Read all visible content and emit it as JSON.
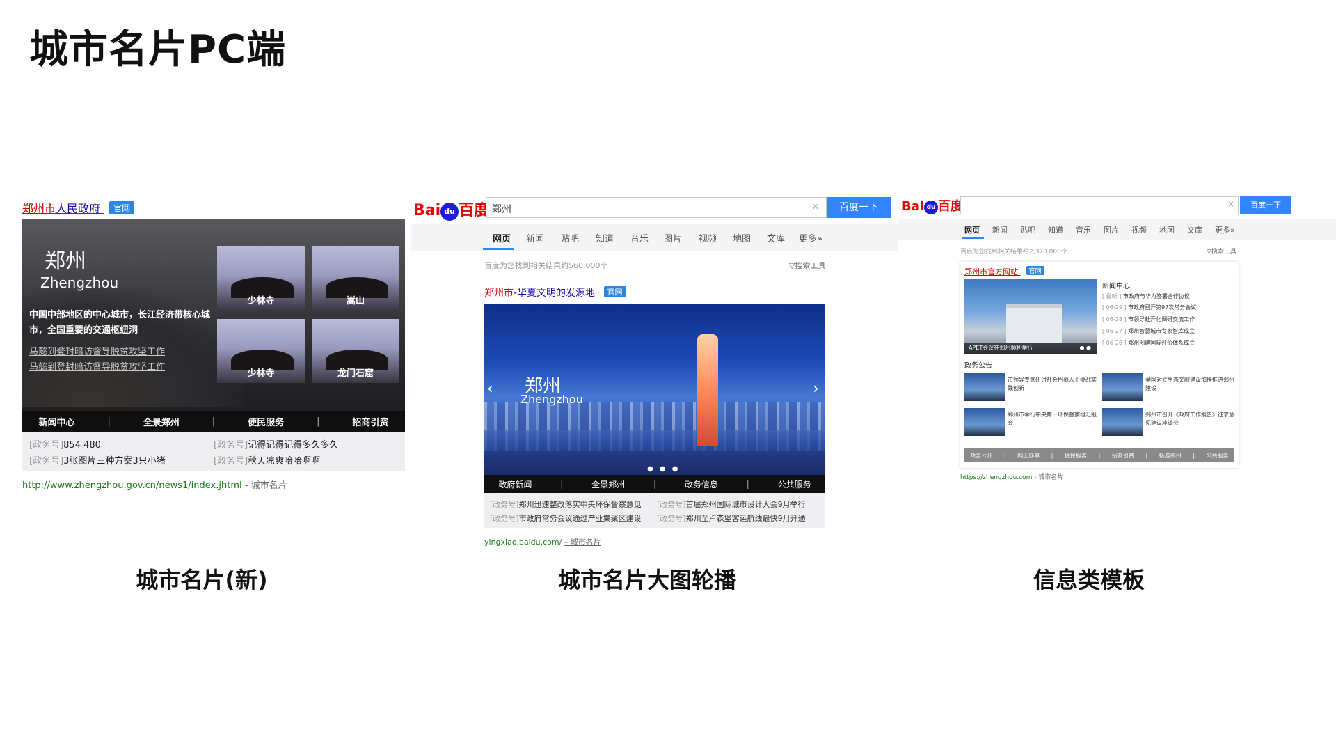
{
  "slide": {
    "title": "城市名片PC端"
  },
  "captions": [
    "城市名片(新)",
    "城市名片大图轮播",
    "信息类模板"
  ],
  "panel1": {
    "title_city": "郑州市",
    "title_rest": "人民政府",
    "badge": "官网",
    "city_cn": "郑州",
    "city_en": "Zhengzhou",
    "desc": "中国中部地区的中心城市，长江经济带核心城市，全国重要的交通枢纽洞",
    "links": [
      "马懿到登封暗访督导脱贫攻坚工作",
      "马懿到登封暗访督导脱贫攻坚工作"
    ],
    "thumbs": [
      "少林寺",
      "嵩山",
      "少林寺",
      "龙门石窟"
    ],
    "nav": [
      "新闻中心",
      "全景郑州",
      "便民服务",
      "招商引资"
    ],
    "info": [
      {
        "tag": "[政务号]",
        "text": "854 480"
      },
      {
        "tag": "[政务号]",
        "text": "记得记得记得多久多久"
      },
      {
        "tag": "[政务号]",
        "text": "3张图片三种方案3只小猪"
      },
      {
        "tag": "[政务号]",
        "text": "秋天凉爽哈哈啊啊"
      }
    ],
    "url": "http://www.zhengzhou.gov.cn/news1/index.jhtml",
    "url_suffix": "- 城市名片"
  },
  "panel2": {
    "logo_bai": "Bai",
    "logo_du": "du",
    "logo_baidu": "百度",
    "search_value": "郑州",
    "clear_icon": "×",
    "search_btn": "百度一下",
    "tabs": [
      "网页",
      "新闻",
      "贴吧",
      "知道",
      "音乐",
      "图片",
      "视频",
      "地图",
      "文库",
      "更多»"
    ],
    "count": "百度为您找到相关结果约560,000个",
    "tools": "▽搜索工具",
    "result_title_red": "郑州市",
    "result_title_rest": "-华夏文明的发源地",
    "badge": "官网",
    "city_cn": "郑州",
    "city_en": "Zhengzhou",
    "arrow_left": "‹",
    "arrow_right": "›",
    "dots": "● ● ●",
    "nav": [
      "政府新闻",
      "全景郑州",
      "政务信息",
      "公共服务"
    ],
    "info": [
      {
        "tag": "[政务号]",
        "text": "郑州迅速整改落实中央环保督察意见"
      },
      {
        "tag": "[政务号]",
        "text": "首届郑州国际城市设计大会9月举行"
      },
      {
        "tag": "[政务号]",
        "text": "市政府常务会议通过产业集聚区建设"
      },
      {
        "tag": "[政务号]",
        "text": "郑州至卢森堡客运航线最快9月开通"
      }
    ],
    "url": "yingxiao.baidu.com/",
    "url_suffix": "– 城市名片"
  },
  "panel3": {
    "logo_bai": "Bai",
    "logo_du": "du",
    "logo_baidu": "百度",
    "search_value": "",
    "clear_icon": "×",
    "search_btn": "百度一下",
    "tabs": [
      "网页",
      "新闻",
      "贴吧",
      "知道",
      "音乐",
      "图片",
      "视频",
      "地图",
      "文库",
      "更多»"
    ],
    "count": "百度为您找到相关结果约2,370,000个",
    "tools": "▽搜索工具",
    "card_title": "郑州市官方网站",
    "badge": "官网",
    "main_img_caption": "APET会议在郑州顺利举行",
    "main_img_dots": "● ●",
    "news_heading": "新闻中心",
    "news": [
      {
        "date": "[ 最新 ]",
        "text": "市政府与华为签署合作协议"
      },
      {
        "date": "[ 06-29 ]",
        "text": "市政府召开第97次常务会议"
      },
      {
        "date": "[ 06-28 ]",
        "text": "市领导赴开化调研交流工作"
      },
      {
        "date": "[ 06-27 ]",
        "text": "郑州智慧城市专家智库成立"
      },
      {
        "date": "[ 06-26 ]",
        "text": "郑州创建国际评价体系成立"
      }
    ],
    "notice_heading": "政务公告",
    "notices": [
      "市领导专家研讨社会招募人士挑战实践创新",
      "举国对立生态文献建设加快推进郑州建设",
      "郑州市举行中央第一环保督察组汇报会",
      "郑州市召开《政府工作报告》征求意见建议座谈会"
    ],
    "bottom_nav": [
      "政务公开",
      "网上办事",
      "便民服务",
      "招商引资",
      "畅游郑州",
      "公共服务"
    ],
    "url": "https://zhengzhou.com",
    "url_suffix": "- 城市名片"
  }
}
